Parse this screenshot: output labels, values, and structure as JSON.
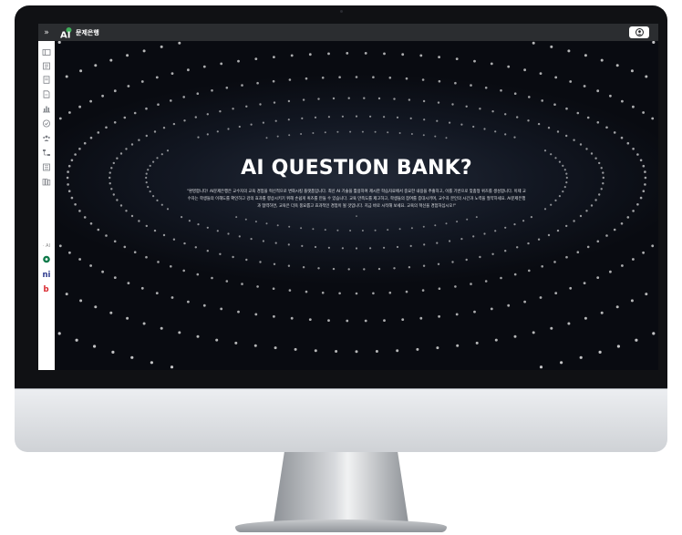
{
  "topbar": {
    "expand_icon": "double-chevron-right-icon",
    "logo_mark": "AI",
    "logo_text": "문제은행",
    "brand_green": "#3fae5a",
    "profile_icon": "user-circle-icon"
  },
  "sidebar": {
    "items": [
      {
        "icon": "card-icon"
      },
      {
        "icon": "list-icon"
      },
      {
        "icon": "document-icon"
      },
      {
        "icon": "file-edit-icon"
      },
      {
        "icon": "chart-icon"
      },
      {
        "icon": "check-circle-icon"
      },
      {
        "icon": "group-icon"
      },
      {
        "icon": "hierarchy-icon"
      },
      {
        "icon": "book-icon"
      },
      {
        "icon": "books-icon"
      }
    ],
    "ai_section_label": "· AI",
    "apps": [
      {
        "icon": "gpt-app-icon",
        "color": "#0f7a4a"
      },
      {
        "icon": "ni-app-icon",
        "label": "ni",
        "color": "#2d3a8c"
      },
      {
        "icon": "b-app-icon",
        "label": "b",
        "color": "#d8262d"
      }
    ]
  },
  "hero": {
    "title": "AI QUESTION BANK?",
    "description": "\"환영합니다! AI문제은행은 교수자의 교육 경험을 혁신적으로 변화시킬 플랫폼입니다. 최신 AI 기술을 활용하여 제시한 학습자료에서 중요한 내용을 추출하고, 이를 기반으로 맞춤형 퀴즈를 생성합니다. 이제 교수자는 학생들의 이해도를 확인하고 강의 효과를 향상시키기 위해 손쉽게 퀴즈를 만들 수 있습니다. 교육 만족도를 제고하고, 학생들의 참여를 증대시키며, 교수자 본인의 시간과 노력을 절약하세요. AI문제은행과 협력하면, 교육은 더욱 풍요롭고 효과적인 경험이 될 것입니다. 지금 바로 시작해 보세요. 교육의 혁신을 경험하십시오!\""
  }
}
